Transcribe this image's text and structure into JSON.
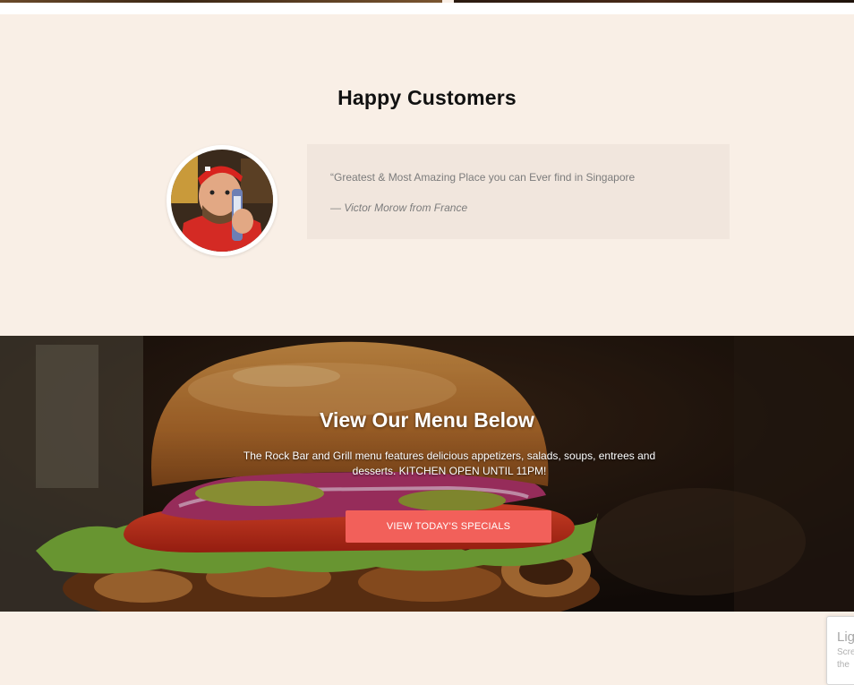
{
  "testimonials": {
    "title": "Happy Customers",
    "quote": "“Greatest & Most Amazing Place you can Ever find in Singapore",
    "author": "— Victor Morow from France"
  },
  "menu_hero": {
    "title": "View Our Menu Below",
    "description": "The Rock Bar and Grill menu features delicious appetizers, salads, soups, entrees and desserts. KITCHEN OPEN UNTIL 11PM!",
    "button_label": "VIEW TODAY'S SPECIALS"
  },
  "corner_widget": {
    "title": "Lig",
    "line1": "Scre",
    "line2": "the"
  },
  "colors": {
    "page_bg": "#f9efe6",
    "quote_bg": "#f1e6dd",
    "accent": "#f2605a"
  }
}
